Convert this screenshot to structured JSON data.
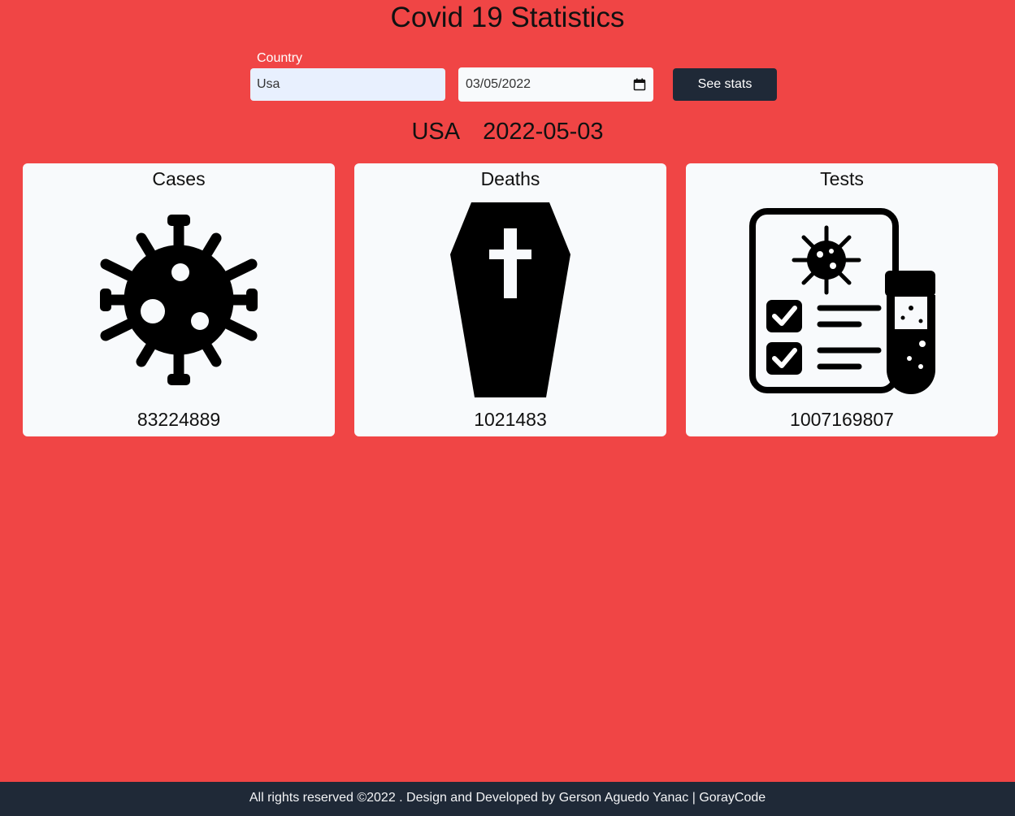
{
  "header": {
    "title": "Covid 19 Statistics"
  },
  "form": {
    "country_label": "Country",
    "country_value": "Usa",
    "date_value": "03/05/2022",
    "submit_label": "See stats"
  },
  "result": {
    "country": "USA",
    "date": "2022-05-03"
  },
  "cards": [
    {
      "title": "Cases",
      "value": "83224889",
      "icon": "virus-icon"
    },
    {
      "title": "Deaths",
      "value": "1021483",
      "icon": "coffin-icon"
    },
    {
      "title": "Tests",
      "value": "1007169807",
      "icon": "test-report-icon"
    }
  ],
  "footer": {
    "text": "All rights reserved ©2022 . Design and Developed by Gerson Aguedo Yanac | GorayCode"
  },
  "colors": {
    "background": "#f04545",
    "card": "#f8fafc",
    "button": "#1f2937",
    "footer": "#1f2937"
  }
}
